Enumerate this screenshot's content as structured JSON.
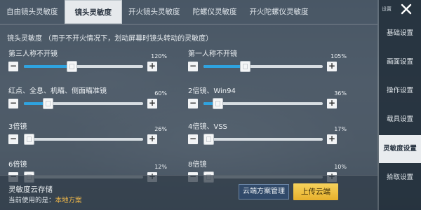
{
  "tabs": [
    {
      "label": "自由镜头灵敏度",
      "active": false
    },
    {
      "label": "镜头灵敏度",
      "active": true
    },
    {
      "label": "开火镜头灵敏度",
      "active": false
    },
    {
      "label": "陀螺仪灵敏度",
      "active": false
    },
    {
      "label": "开火陀螺仪灵敏度",
      "active": false
    }
  ],
  "section_title": "镜头灵敏度 （用于不开火情况下，划动屏幕时镜头转动的灵敏度）",
  "sliders": [
    {
      "label": "第三人称不开镜",
      "value_text": "120%",
      "level": 0.4
    },
    {
      "label": "第一人称不开镜",
      "value_text": "105%",
      "level": 0.35
    },
    {
      "label": "红点、全息、机瞄、侧面瞄准镜",
      "value_text": "60%",
      "level": 0.2
    },
    {
      "label": "2倍镜、Win94",
      "value_text": "36%",
      "level": 0.12
    },
    {
      "label": "3倍镜",
      "value_text": "26%",
      "level": 0.03
    },
    {
      "label": "4倍镜、VSS",
      "value_text": "17%",
      "level": 0.03
    },
    {
      "label": "6倍镜",
      "value_text": "12%",
      "level": 0.03
    },
    {
      "label": "8倍镜",
      "value_text": "10%",
      "level": 0.03
    }
  ],
  "footer": {
    "title": "灵敏度云存储",
    "current_prefix": "当前使用的是：",
    "current_value": "本地方案",
    "manage_label": "云端方案管理",
    "upload_label": "上传云端"
  },
  "sidebar": {
    "top_label": "设置",
    "items": [
      {
        "label": "基础设置",
        "active": false
      },
      {
        "label": "画面设置",
        "active": false
      },
      {
        "label": "操作设置",
        "active": false
      },
      {
        "label": "载具设置",
        "active": false
      },
      {
        "label": "灵敏度设置",
        "active": true
      },
      {
        "label": "拾取设置",
        "active": false
      }
    ]
  },
  "colors": {
    "accent": "#2ea3e0",
    "upload": "#f0c040",
    "highlight": "#f0b84a"
  }
}
